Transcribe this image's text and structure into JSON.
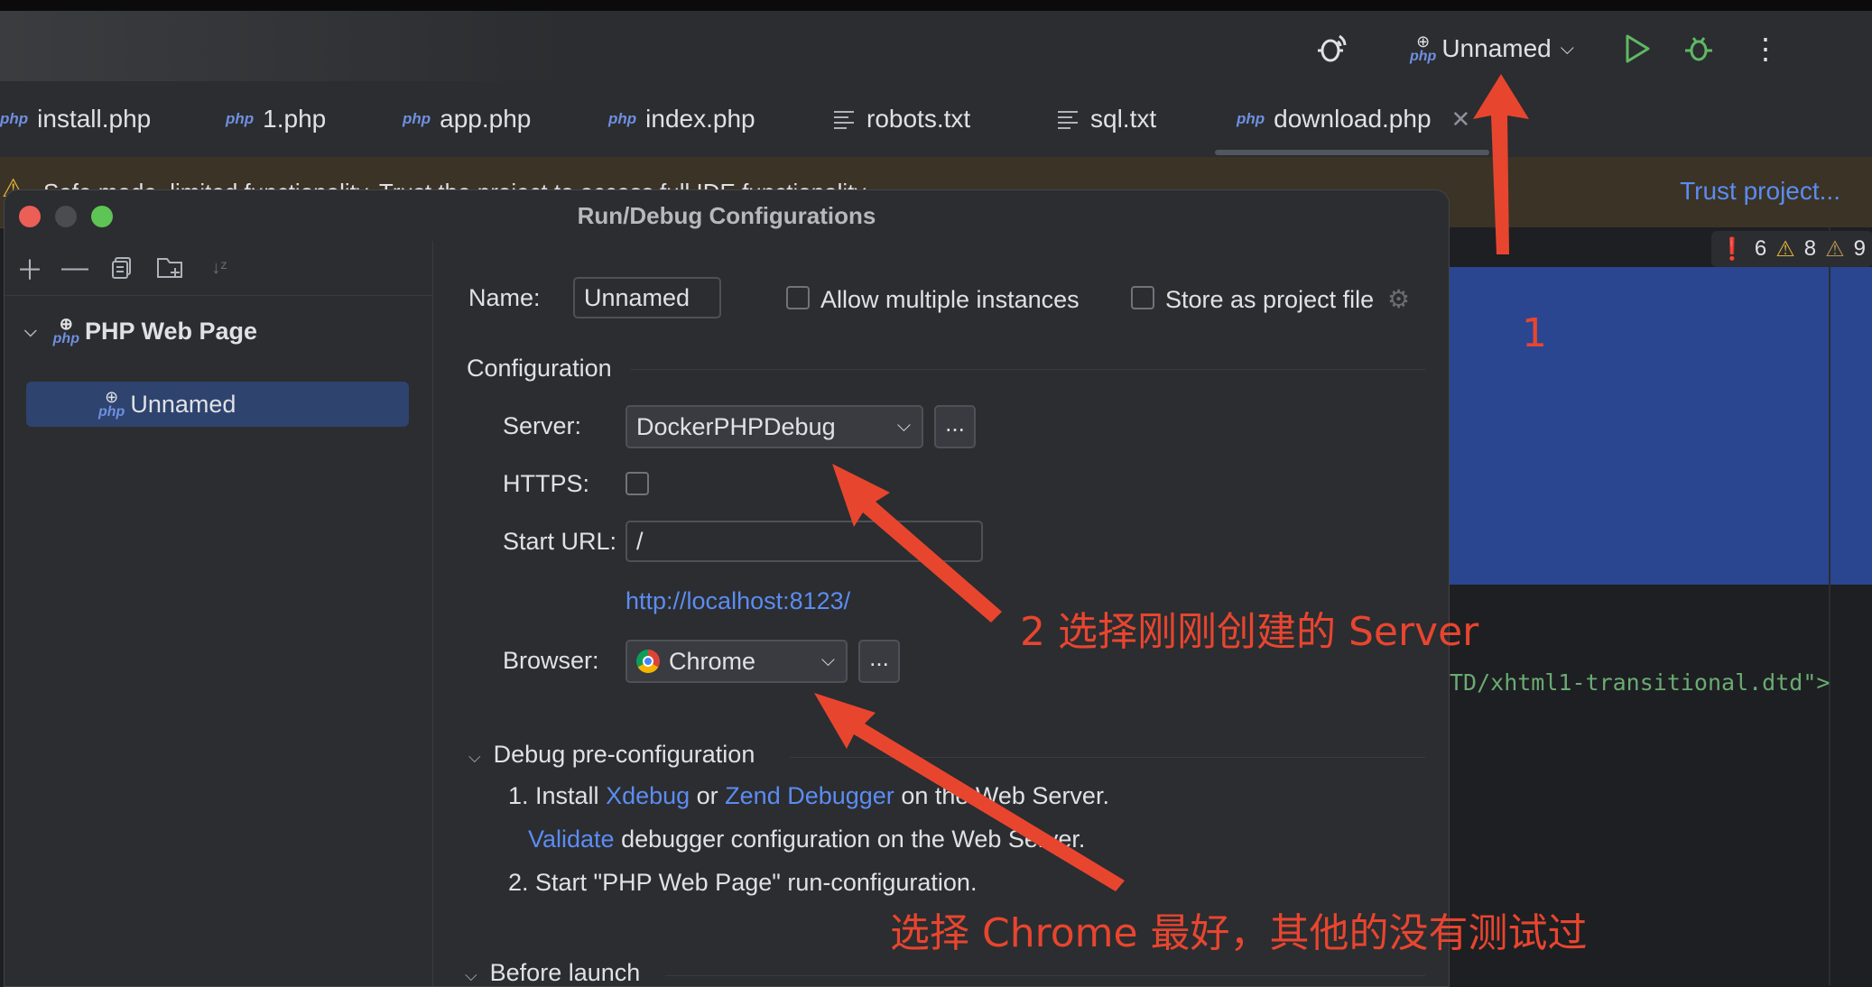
{
  "toolbar": {
    "run_config_name": "Unnamed",
    "icons": [
      "debug-listen-icon",
      "php-icon",
      "chevron-down-icon",
      "run-icon",
      "debug-icon",
      "more-icon"
    ]
  },
  "tabs": [
    {
      "label": "install.php",
      "type": "php"
    },
    {
      "label": "1.php",
      "type": "php"
    },
    {
      "label": "app.php",
      "type": "php"
    },
    {
      "label": "index.php",
      "type": "php"
    },
    {
      "label": "robots.txt",
      "type": "txt"
    },
    {
      "label": "sql.txt",
      "type": "txt"
    },
    {
      "label": "download.php",
      "type": "php",
      "active": true
    }
  ],
  "tab_php_badge": "php",
  "warning": {
    "message": "Safe mode, limited functionality. Trust the project to access full IDE functionality.",
    "trust_link": "Trust project..."
  },
  "inspections": {
    "errors": "6",
    "warnings": "8",
    "weak_warnings": "9"
  },
  "editor": {
    "code_fragment": "TD/xhtml1-transitional.dtd\">"
  },
  "dialog": {
    "title": "Run/Debug Configurations",
    "tree": {
      "root": "PHP Web Page",
      "child": "Unnamed",
      "php_badge": "php"
    },
    "name_label": "Name:",
    "name_value": "Unnamed",
    "allow_multiple": "Allow multiple instances",
    "store_project": "Store as project file",
    "configuration": "Configuration",
    "server_label": "Server:",
    "server_value": "DockerPHPDebug",
    "dots": "...",
    "https_label": "HTTPS:",
    "start_url_label": "Start URL:",
    "start_url_value": "/",
    "resolved_url": "http://localhost:8123/",
    "browser_label": "Browser:",
    "browser_value": "Chrome",
    "debug_pre": "Debug pre-configuration",
    "step1_prefix": "1. Install ",
    "xdebug": "Xdebug",
    "or": " or ",
    "zend": "Zend Debugger",
    "step1_suffix": " on the Web Server.",
    "validate": "Validate",
    "validate_suffix": " debugger configuration on the Web Server.",
    "step2": "2. Start \"PHP Web Page\" run-configuration.",
    "before_launch": "Before launch"
  },
  "annotations": {
    "a1": "1",
    "a2": "2 选择刚刚创建的 Server",
    "a3": "选择 Chrome 最好，其他的没有测试过",
    "color": "#e8452f"
  }
}
